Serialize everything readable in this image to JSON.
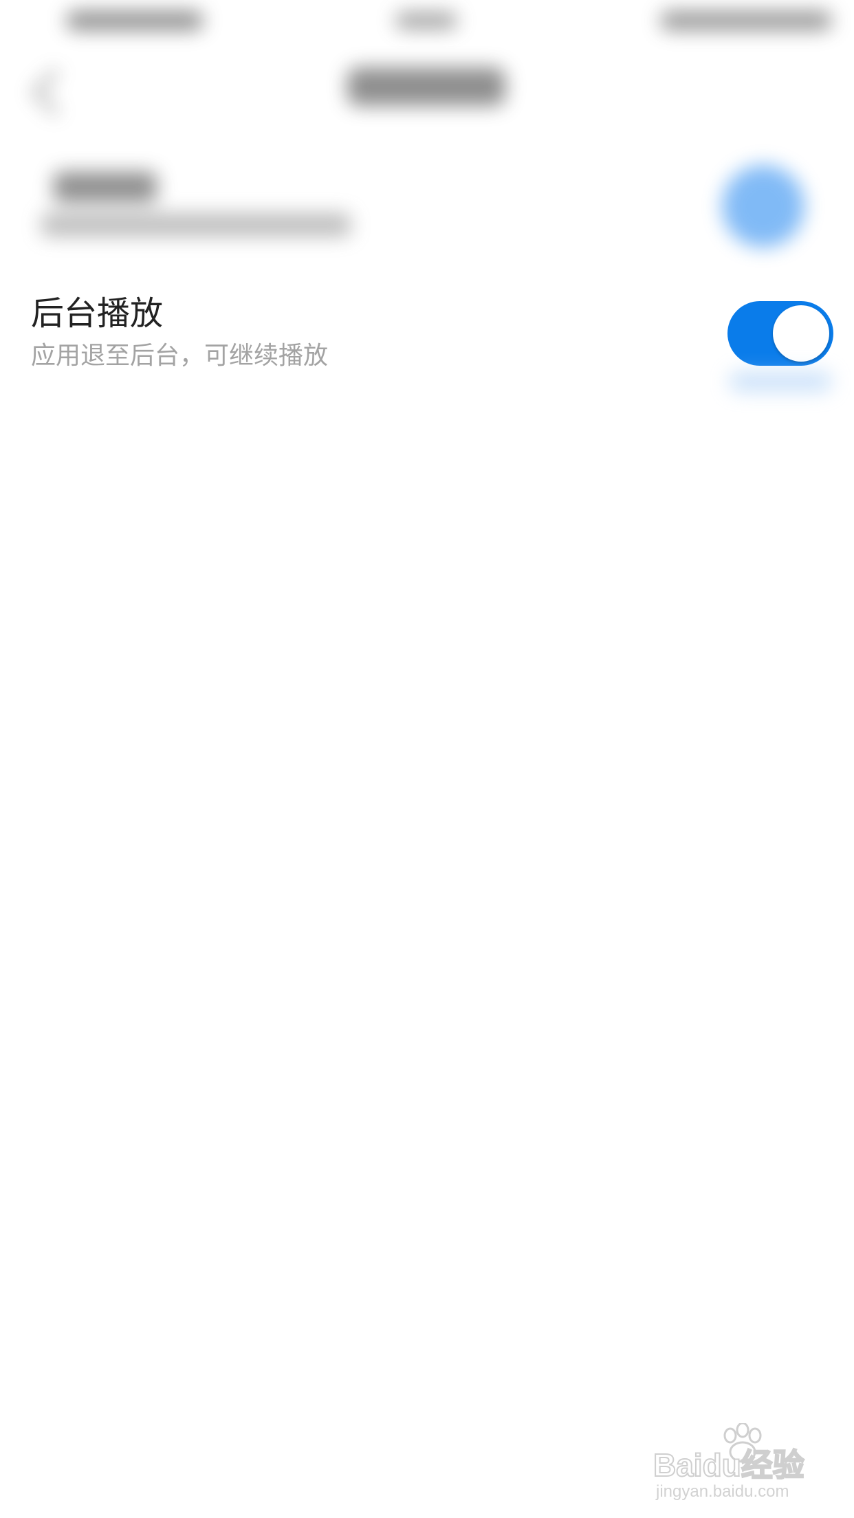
{
  "setting": {
    "title": "后台播放",
    "subtitle": "应用退至后台，可继续播放",
    "enabled": true
  },
  "watermark": {
    "brand": "Baidu经验",
    "url": "jingyan.baidu.com"
  },
  "colors": {
    "accent": "#0a7cea",
    "title_text": "#222222",
    "subtitle_text": "#a3a3a3",
    "background": "#ffffff"
  },
  "icons": {
    "toggle": "toggle-switch-on",
    "back": "back-arrow-icon",
    "watermark": "baidu-paw-icon"
  }
}
